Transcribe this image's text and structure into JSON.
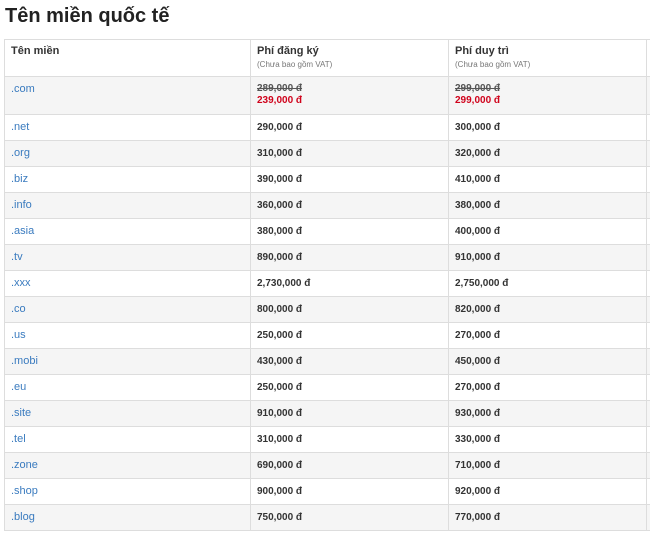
{
  "title": "Tên miền quốc tế",
  "headers": {
    "domain": "Tên miền",
    "register": "Phí đăng ký",
    "register_note": "(Chưa bao gồm VAT)",
    "renew": "Phí duy trì",
    "renew_note": "(Chưa bao gồm VAT)"
  },
  "featured": {
    "domain": ".com",
    "register_old": "289,000 đ",
    "register_new": "239,000 đ",
    "renew_old": "299,000 đ",
    "renew_new": "299,000 đ"
  },
  "rows": [
    {
      "domain": ".net",
      "register": "290,000 đ",
      "renew": "300,000 đ"
    },
    {
      "domain": ".org",
      "register": "310,000 đ",
      "renew": "320,000 đ"
    },
    {
      "domain": ".biz",
      "register": "390,000 đ",
      "renew": "410,000 đ"
    },
    {
      "domain": ".info",
      "register": "360,000 đ",
      "renew": "380,000 đ"
    },
    {
      "domain": ".asia",
      "register": "380,000 đ",
      "renew": "400,000 đ"
    },
    {
      "domain": ".tv",
      "register": "890,000 đ",
      "renew": "910,000 đ"
    },
    {
      "domain": ".xxx",
      "register": "2,730,000 đ",
      "renew": "2,750,000 đ"
    },
    {
      "domain": ".co",
      "register": "800,000 đ",
      "renew": "820,000 đ"
    },
    {
      "domain": ".us",
      "register": "250,000 đ",
      "renew": "270,000 đ"
    },
    {
      "domain": ".mobi",
      "register": "430,000 đ",
      "renew": "450,000 đ"
    },
    {
      "domain": ".eu",
      "register": "250,000 đ",
      "renew": "270,000 đ"
    },
    {
      "domain": ".site",
      "register": "910,000 đ",
      "renew": "930,000 đ"
    },
    {
      "domain": ".tel",
      "register": "310,000 đ",
      "renew": "330,000 đ"
    },
    {
      "domain": ".zone",
      "register": "690,000 đ",
      "renew": "710,000 đ"
    },
    {
      "domain": ".shop",
      "register": "900,000 đ",
      "renew": "920,000 đ"
    },
    {
      "domain": ".blog",
      "register": "750,000 đ",
      "renew": "770,000 đ"
    }
  ],
  "colors": {
    "link": "#3a7bbf",
    "discount": "#d0021b",
    "row_alt": "#f5f5f5",
    "border": "#dddddd"
  }
}
